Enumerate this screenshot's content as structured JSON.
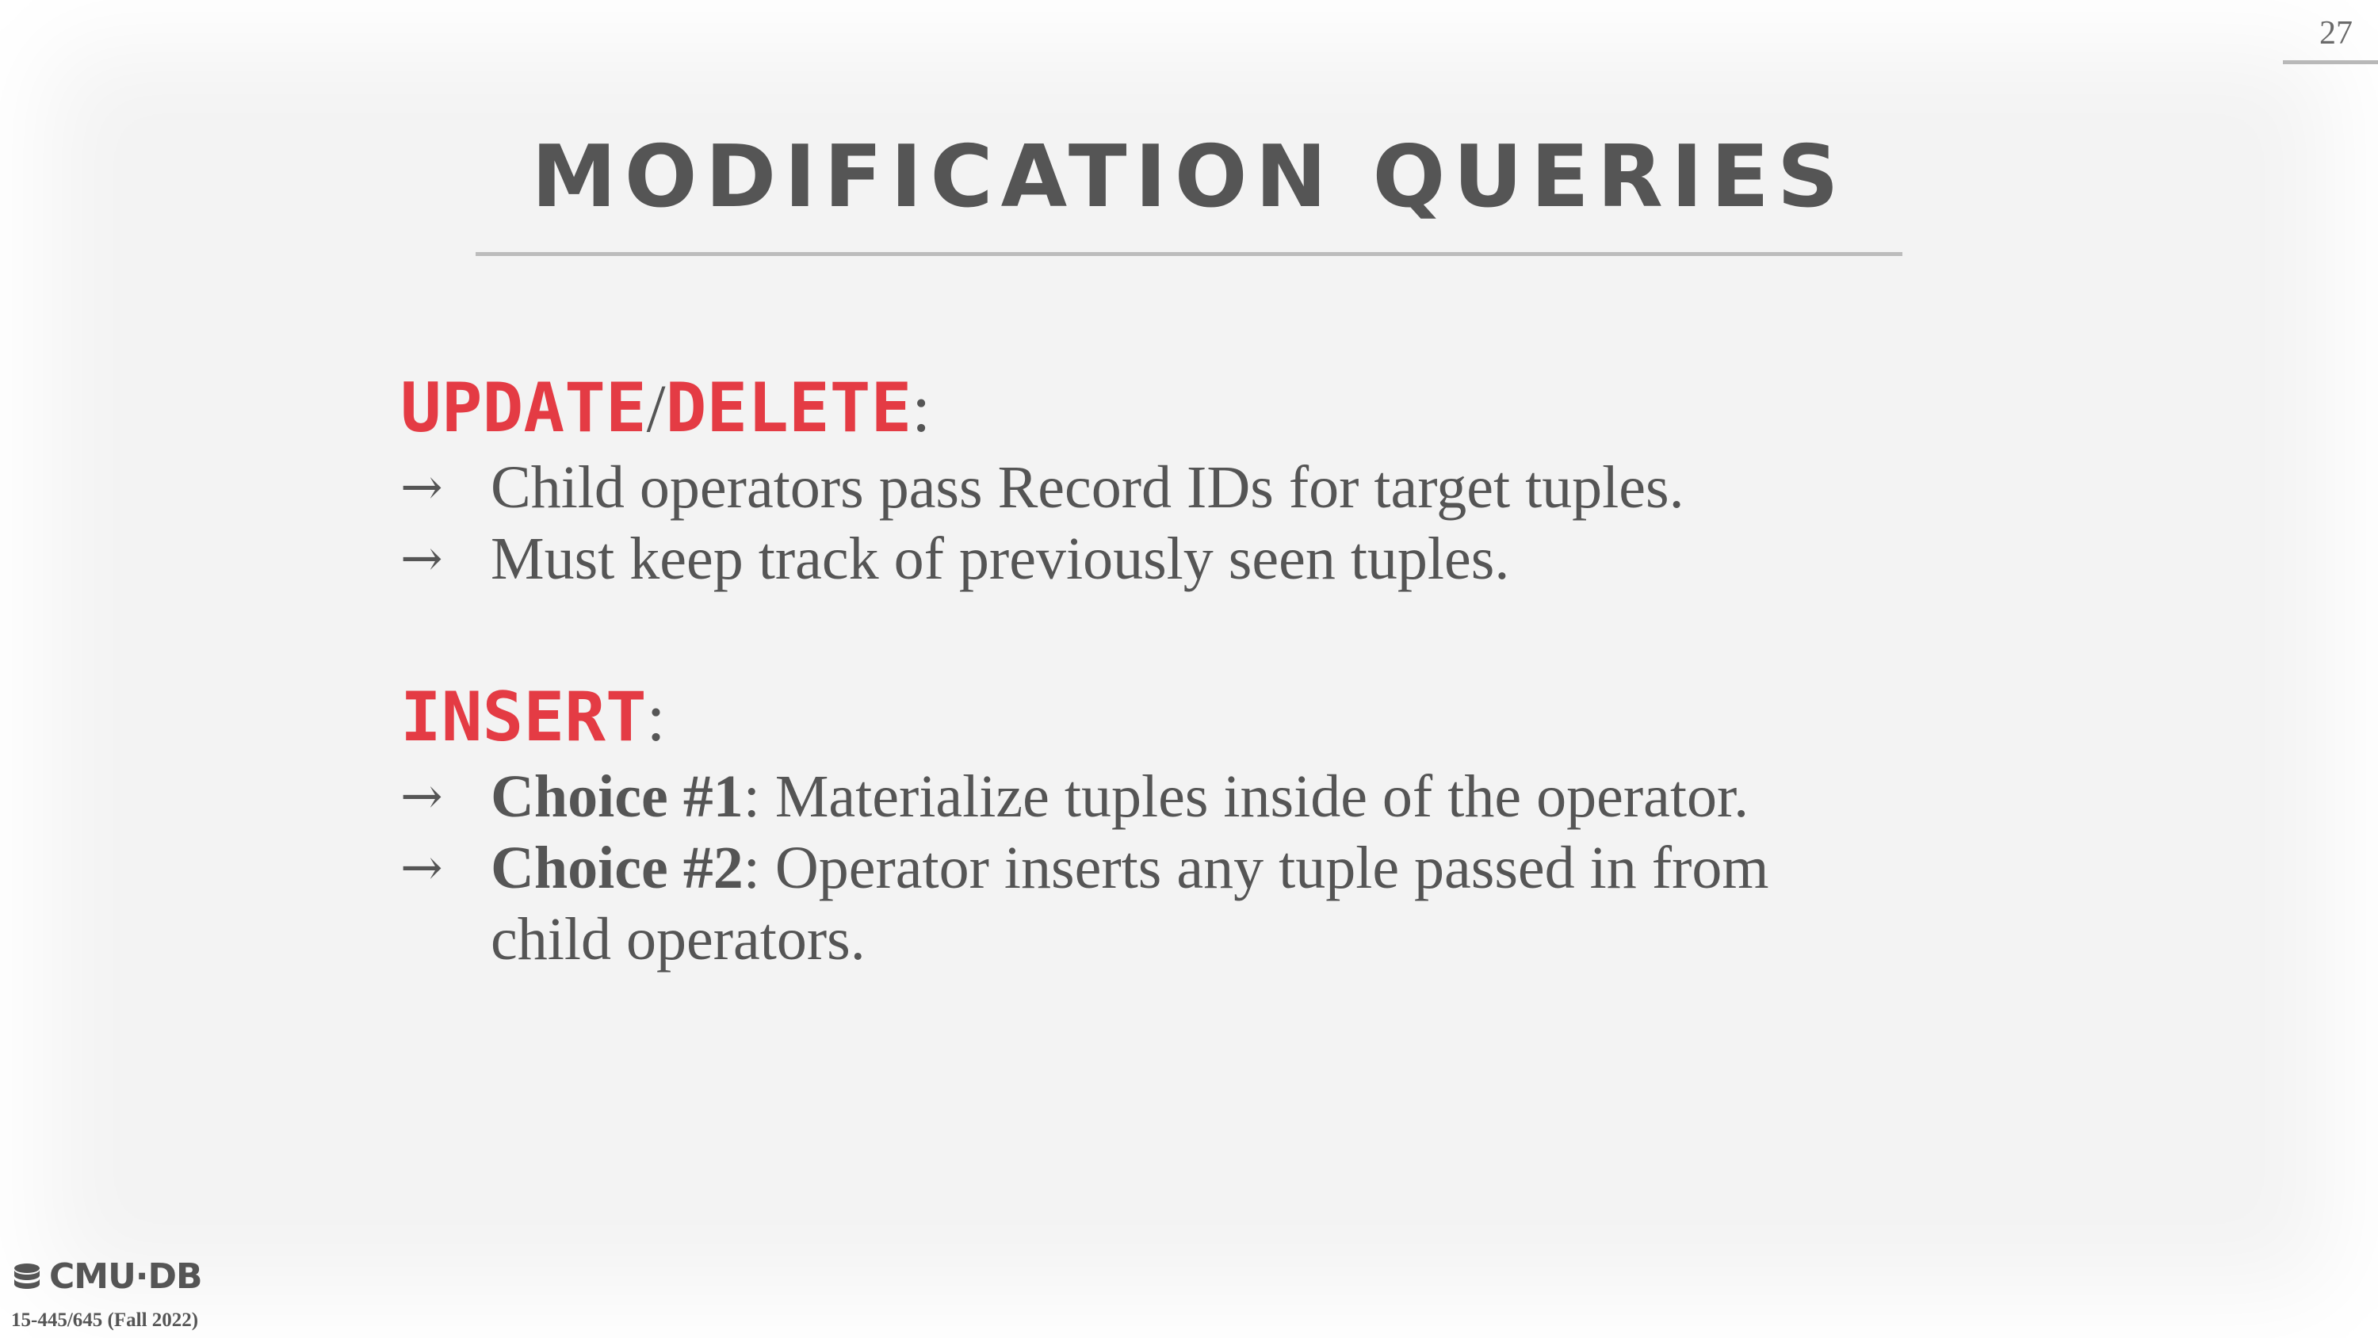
{
  "page_number": "27",
  "title": "MODIFICATION QUERIES",
  "sections": {
    "update_delete": {
      "keyword1": "UPDATE",
      "separator": "/",
      "keyword2": "DELETE",
      "colon": ":",
      "bullets": [
        "Child operators pass Record IDs for target tuples.",
        "Must keep track of previously seen tuples."
      ]
    },
    "insert": {
      "keyword": "INSERT",
      "colon": ":",
      "bullets": [
        {
          "label": "Choice #1",
          "text": ": Materialize tuples inside of the operator."
        },
        {
          "label": "Choice #2",
          "text": ": Operator inserts any tuple passed in from",
          "continuation": "child operators."
        }
      ]
    }
  },
  "arrow_glyph": "→",
  "footer": {
    "logo_text": "CMU·DB",
    "course": "15-445/645 (Fall 2022)"
  },
  "colors": {
    "keyword": "#e43b44",
    "text": "#555555",
    "background": "#f3f3f3"
  }
}
